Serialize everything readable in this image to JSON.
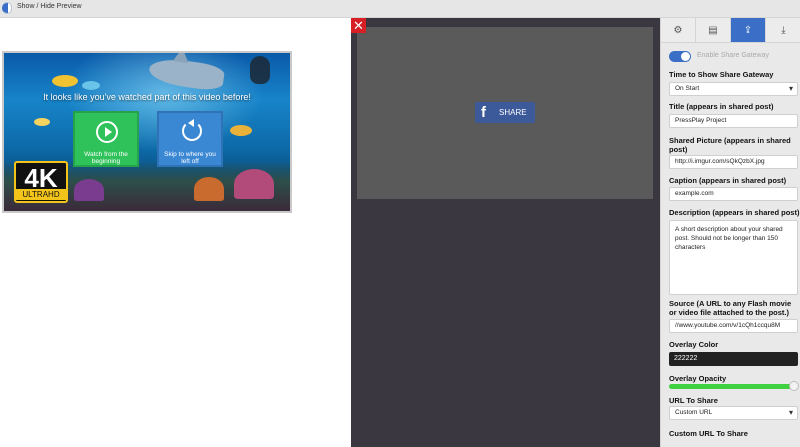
{
  "topbar": {
    "toggle_label": "Show / Hide Preview"
  },
  "video": {
    "resume_title": "It looks like you've watched part of this video before!",
    "buttons": [
      {
        "label": "Watch from the beginning",
        "icon": "play-circle-icon"
      },
      {
        "label": "Skip to where you left off",
        "icon": "restart-icon"
      }
    ],
    "badge_big": "4K",
    "badge_small": "ULTRAHD"
  },
  "stage": {
    "close_icon": "✕",
    "share_fb": "f",
    "share_label": "SHARE",
    "brand_color": "#3c5a99"
  },
  "panel": {
    "tabs": [
      {
        "name": "settings",
        "icon": "⚙"
      },
      {
        "name": "document",
        "icon": "▤"
      },
      {
        "name": "share",
        "icon": "⇪"
      },
      {
        "name": "download",
        "icon": "⤓"
      }
    ],
    "active_tab": "share",
    "enable_label": "Enable Share Gateway",
    "enabled": true,
    "time_label": "Time to Show Share Gateway",
    "time_value": "On Start",
    "title_label": "Title (appears in shared post)",
    "title_value": "PressPlay Project",
    "picture_label": "Shared Picture (appears in shared post)",
    "picture_value": "http://i.imgur.com/sQkQzbX.jpg",
    "caption_label": "Caption (appears in shared post)",
    "caption_value": "example.com",
    "description_label": "Description (appears in shared post)",
    "description_value": "A short description about your shared post. Should not be longer than 150 characters",
    "source_label": "Source (A URL to any Flash movie or video file attached to the post.)",
    "source_value": "//www.youtube.com/v/1cQh1ccqu8M",
    "overlay_color_label": "Overlay Color",
    "overlay_color_value": "222222",
    "overlay_opacity_label": "Overlay Opacity",
    "overlay_opacity": 0.97,
    "url_share_label": "URL To Share",
    "url_share_value": "Custom URL",
    "custom_url_label": "Custom URL To Share"
  }
}
